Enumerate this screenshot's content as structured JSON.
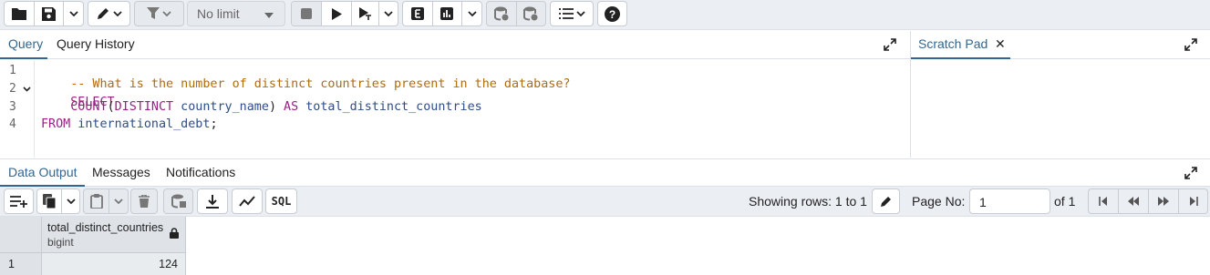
{
  "toolbar": {
    "limit_value": "No limit"
  },
  "editor_tabs": {
    "query": "Query",
    "history": "Query History"
  },
  "scratch": {
    "tab": "Scratch Pad",
    "close": "✕"
  },
  "editor": {
    "line_numbers": [
      "1",
      "2",
      "3",
      "4"
    ],
    "line1_comment": "-- What is the number of distinct countries present in the database?",
    "line2_kw": "SELECT",
    "line3_indent": "    ",
    "line3_fn": "COUNT",
    "line3_open": "(",
    "line3_kw_distinct": "DISTINCT",
    "line3_col": " country_name",
    "line3_close": ")",
    "line3_kw_as": " AS",
    "line3_alias": " total_distinct_countries",
    "line4_kw": "FROM",
    "line4_table": " international_debt",
    "line4_semi": ";"
  },
  "output_tabs": {
    "data_output": "Data Output",
    "messages": "Messages",
    "notifications": "Notifications"
  },
  "output_toolbar": {
    "sql_label": "SQL",
    "rows_text": "Showing rows: 1 to 1",
    "page_label": "Page No:",
    "page_value": "1",
    "of_text": "of 1"
  },
  "grid": {
    "column_name": "total_distinct_countries",
    "column_type": "bigint",
    "row_number": "1",
    "cell_value": "124"
  },
  "colors": {
    "accent": "#326690",
    "toolbar_bg": "#ebeef3",
    "keyword": "#9b1f85",
    "comment": "#b06b0b",
    "identifier": "#2e4d8a"
  }
}
